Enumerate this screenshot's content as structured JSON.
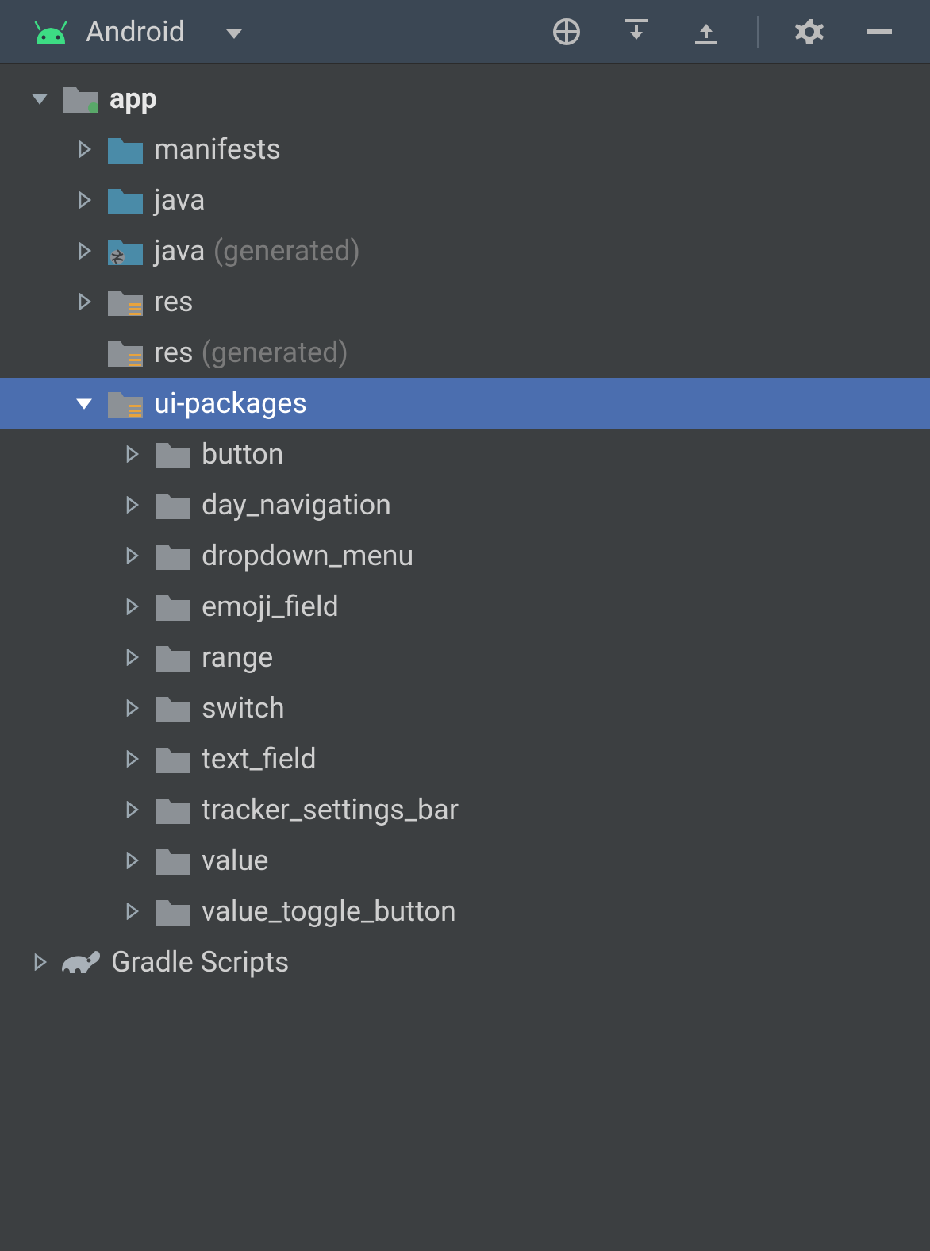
{
  "header": {
    "title": "Android"
  },
  "tree": {
    "root": {
      "label": "app",
      "expanded": true,
      "children": [
        {
          "label": "manifests",
          "expanded": false,
          "iconType": "module",
          "secondary": null
        },
        {
          "label": "java",
          "expanded": false,
          "iconType": "module",
          "secondary": null
        },
        {
          "label": "java",
          "expanded": false,
          "iconType": "generated",
          "secondary": "(generated)"
        },
        {
          "label": "res",
          "expanded": false,
          "iconType": "resource",
          "secondary": null
        },
        {
          "label": "res",
          "expanded": null,
          "iconType": "resource",
          "secondary": "(generated)"
        },
        {
          "label": "ui-packages",
          "expanded": true,
          "iconType": "resource",
          "secondary": null,
          "selected": true,
          "children": [
            {
              "label": "button"
            },
            {
              "label": "day_navigation"
            },
            {
              "label": "dropdown_menu"
            },
            {
              "label": "emoji_field"
            },
            {
              "label": "range"
            },
            {
              "label": "switch"
            },
            {
              "label": "text_field"
            },
            {
              "label": "tracker_settings_bar"
            },
            {
              "label": "value"
            },
            {
              "label": "value_toggle_button"
            }
          ]
        }
      ]
    },
    "gradle": {
      "label": "Gradle Scripts",
      "expanded": false
    }
  }
}
